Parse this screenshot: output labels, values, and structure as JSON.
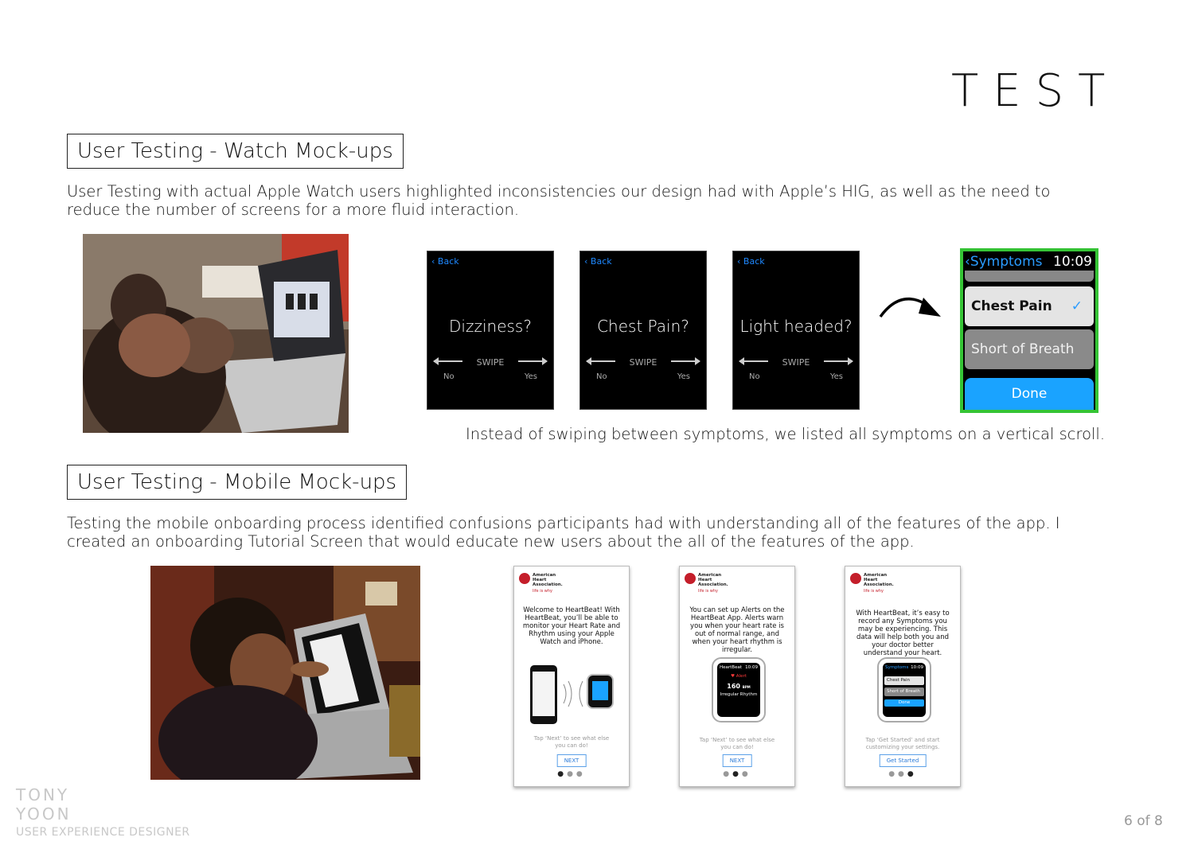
{
  "page_title": "TEST",
  "section1": {
    "heading": "User Testing - Watch Mock-ups",
    "text": "User Testing with actual Apple Watch users highlighted inconsistencies our design had with Apple’s HIG, as well as the need to reduce the number of screens for a more fluid interaction.",
    "watch_screens": [
      {
        "back": "Back",
        "question": "Dizziness?",
        "swipe": "SWIPE",
        "no": "No",
        "yes": "Yes"
      },
      {
        "back": "Back",
        "question": "Chest Pain?",
        "swipe": "SWIPE",
        "no": "No",
        "yes": "Yes"
      },
      {
        "back": "Back",
        "question": "Light headed?",
        "swipe": "SWIPE",
        "no": "No",
        "yes": "Yes"
      }
    ],
    "new_screen": {
      "title": "Symptoms",
      "time": "10:09",
      "items": [
        "Chest Pain",
        "Short of Breath"
      ],
      "selected_item": "Chest Pain",
      "done": "Done",
      "highlight_color": "#35c435"
    },
    "caption": "Instead of swiping between symptoms, we listed all symptoms on a vertical scroll."
  },
  "section2": {
    "heading": "User Testing - Mobile Mock-ups",
    "text": "Testing the mobile onboarding process identified confusions participants had with understanding all of the features of the app. I created an onboarding Tutorial Screen that would educate new users about the all of the features of the app.",
    "phones": [
      {
        "body": "Welcome to HeartBeat! With HeartBeat, you’ll be able to monitor your Heart Rate and Rhythm using your Apple Watch and iPhone.",
        "hint": "Tap ‘Next’ to see what else you can do!",
        "button": "NEXT",
        "active_dot": 1
      },
      {
        "body": "You can set up Alerts on the HeartBeat App. Alerts warn you when your heart rate is out of normal range, and when your heart rhythm is irregular.",
        "watch_lines": [
          "HeartBeat",
          "10:09",
          "Alert",
          "160",
          "BPM",
          "Irregular Rhythm"
        ],
        "hint": "Tap ‘Next’ to see what else you can do!",
        "button": "NEXT",
        "active_dot": 2
      },
      {
        "body": "With HeartBeat, it’s easy to record any Symptoms you may be experiencing. This data will help both you and your doctor better understand your heart.",
        "watch_lines": [
          "Symptoms",
          "10:09",
          "Chest Pain",
          "Short of Breath",
          "Done"
        ],
        "hint": "Tap ‘Get Started’ and start customizing your settings.",
        "button": "Get Started",
        "active_dot": 3
      }
    ],
    "org_logo_text": [
      "American",
      "Heart",
      "Association."
    ],
    "org_tagline": "life is why"
  },
  "footer": {
    "name_line1": "TONY",
    "name_line2": "YOON",
    "role": "USER EXPERIENCE DESIGNER",
    "page_number": "6 of 8"
  }
}
